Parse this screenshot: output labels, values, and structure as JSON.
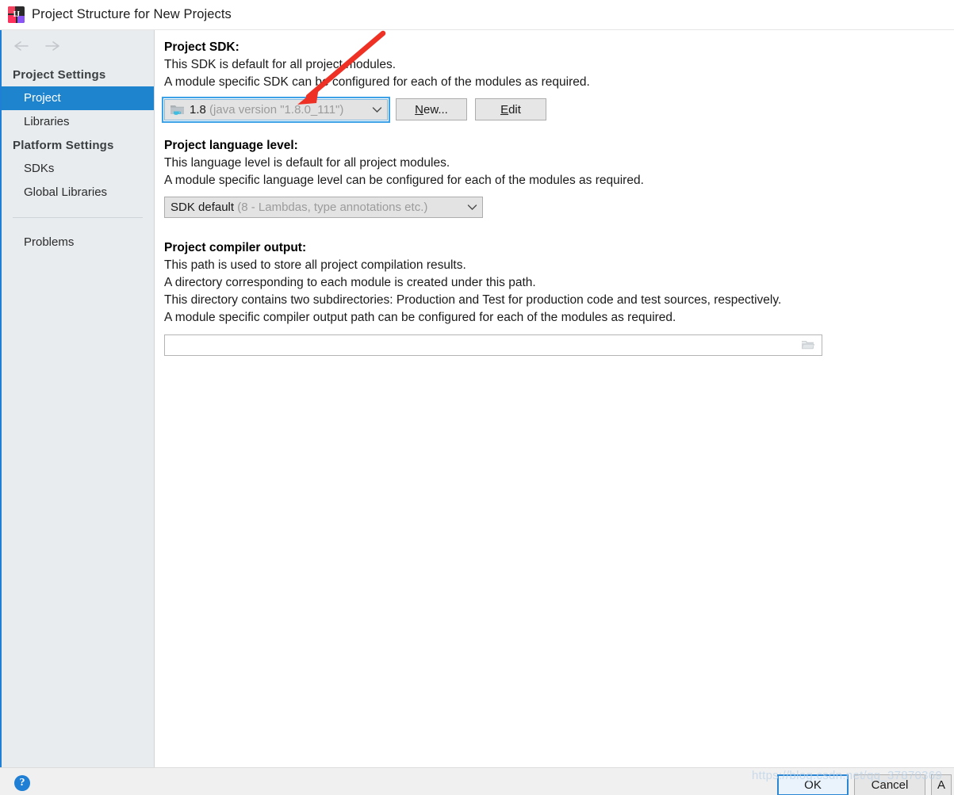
{
  "window": {
    "title": "Project Structure for New Projects",
    "icon": "intellij-idea-logo"
  },
  "nav": {
    "back_icon": "arrow-left-icon",
    "forward_icon": "arrow-right-icon"
  },
  "sidebar": {
    "sections": [
      {
        "label": "Project Settings",
        "items": [
          {
            "label": "Project",
            "selected": true
          },
          {
            "label": "Libraries",
            "selected": false
          }
        ]
      },
      {
        "label": "Platform Settings",
        "items": [
          {
            "label": "SDKs",
            "selected": false
          },
          {
            "label": "Global Libraries",
            "selected": false
          }
        ]
      }
    ],
    "extra_items": [
      {
        "label": "Problems"
      }
    ]
  },
  "main": {
    "sdk": {
      "title": "Project SDK:",
      "lines": [
        "This SDK is default for all project modules.",
        "A module specific SDK can be configured for each of the modules as required."
      ],
      "combo": {
        "icon": "jdk-folder-icon",
        "value": "1.8",
        "detail": "(java version \"1.8.0_111\")",
        "chevron": "chevron-down-icon"
      },
      "new_button": {
        "prefix": "",
        "mnemonic": "N",
        "suffix": "ew..."
      },
      "edit_button": {
        "prefix": "",
        "mnemonic": "E",
        "suffix": "dit"
      }
    },
    "language_level": {
      "title": "Project language level:",
      "lines": [
        "This language level is default for all project modules.",
        "A module specific language level can be configured for each of the modules as required."
      ],
      "combo": {
        "value": "SDK default",
        "detail": "(8 - Lambdas, type annotations etc.)",
        "chevron": "chevron-down-icon"
      }
    },
    "compiler_output": {
      "title": "Project compiler output:",
      "lines": [
        "This path is used to store all project compilation results.",
        "A directory corresponding to each module is created under this path.",
        "This directory contains two subdirectories: Production and Test for production code and test sources, respectively.",
        "A module specific compiler output path can be configured for each of the modules as required."
      ],
      "path_value": "",
      "path_placeholder": "",
      "browse_icon": "folder-browse-icon"
    }
  },
  "bottom": {
    "help_label": "?",
    "ok_label": "OK",
    "cancel_label": "Cancel",
    "apply_label": "A"
  },
  "watermark": {
    "text": "https://blog.csdn.net/qq_37870369"
  },
  "annotation": {
    "type": "red-arrow",
    "color": "#ee3124",
    "points_to": "project-sdk-combo"
  },
  "colors": {
    "selection_blue": "#1e84cd",
    "focus_blue": "#3da1e8",
    "window_border": "#1f7fd4",
    "sidebar_bg": "#e8ecef",
    "annotation_red": "#ee3124"
  }
}
